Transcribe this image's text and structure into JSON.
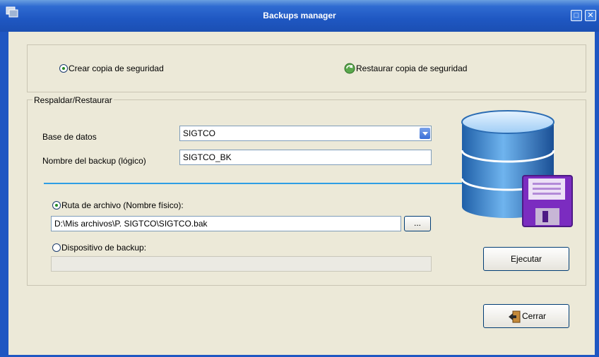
{
  "window": {
    "title": "Backups manager",
    "icon": "backup-app-icon"
  },
  "mode": {
    "create_label": "Crear copia de seguridad",
    "restore_label": "Restaurar copia de seguridad",
    "create_selected": true
  },
  "group": {
    "title": "Respaldar/Restaurar",
    "database_label": "Base de datos",
    "database_value": "SIGTCO",
    "backup_name_label": "Nombre del backup (lógico)",
    "backup_name_value": "SIGTCO_BK",
    "path_option_label": "Ruta de archivo (Nombre físico):",
    "path_value": "D:\\Mis archivos\\P. SIGTCO\\SIGTCO.bak",
    "browse_label": "...",
    "device_option_label": "Dispositivo de backup:",
    "device_value": ""
  },
  "buttons": {
    "execute": "Ejecutar",
    "close": "Cerrar"
  },
  "icons": [
    "backup-app-icon",
    "maximize-icon",
    "close-icon",
    "radio-icon",
    "restore-icon",
    "dropdown-arrow-icon",
    "database-icon",
    "floppy-disk-icon",
    "close-door-icon"
  ]
}
